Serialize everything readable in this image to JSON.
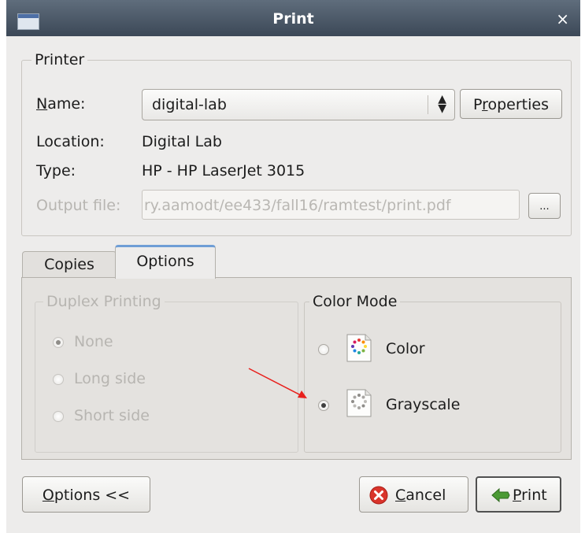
{
  "window": {
    "title": "Print",
    "close_glyph": "×"
  },
  "printer": {
    "legend": "Printer",
    "name_label": "Name:",
    "name_value": "digital-lab",
    "combo_arrows": "⬆⬇",
    "properties_button": "Properties",
    "location_label": "Location:",
    "location_value": "Digital Lab",
    "type_label": "Type:",
    "type_value": "HP - HP LaserJet 3015",
    "output_file_label": "Output file:",
    "output_file_value": "ry.aamodt/ee433/fall16/ramtest/print.pdf",
    "browse_button": "..."
  },
  "tabs": [
    {
      "label": "Copies",
      "active": false
    },
    {
      "label": "Options",
      "active": true
    }
  ],
  "duplex": {
    "legend": "Duplex Printing",
    "options": [
      {
        "label": "None",
        "selected": true
      },
      {
        "label": "Long side",
        "selected": false
      },
      {
        "label": "Short side",
        "selected": false
      }
    ]
  },
  "color_mode": {
    "legend": "Color Mode",
    "options": [
      {
        "label": "Color",
        "selected": false
      },
      {
        "label": "Grayscale",
        "selected": true
      }
    ]
  },
  "buttons": {
    "options_toggle": "Options <<",
    "cancel": "Cancel",
    "print": "Print"
  },
  "annotation": {
    "arrow_color": "#e8201c"
  },
  "colors": {
    "tab_accent": "#6f9ed6",
    "cancel_icon": "#d9342b",
    "print_icon": "#4b9a35"
  }
}
